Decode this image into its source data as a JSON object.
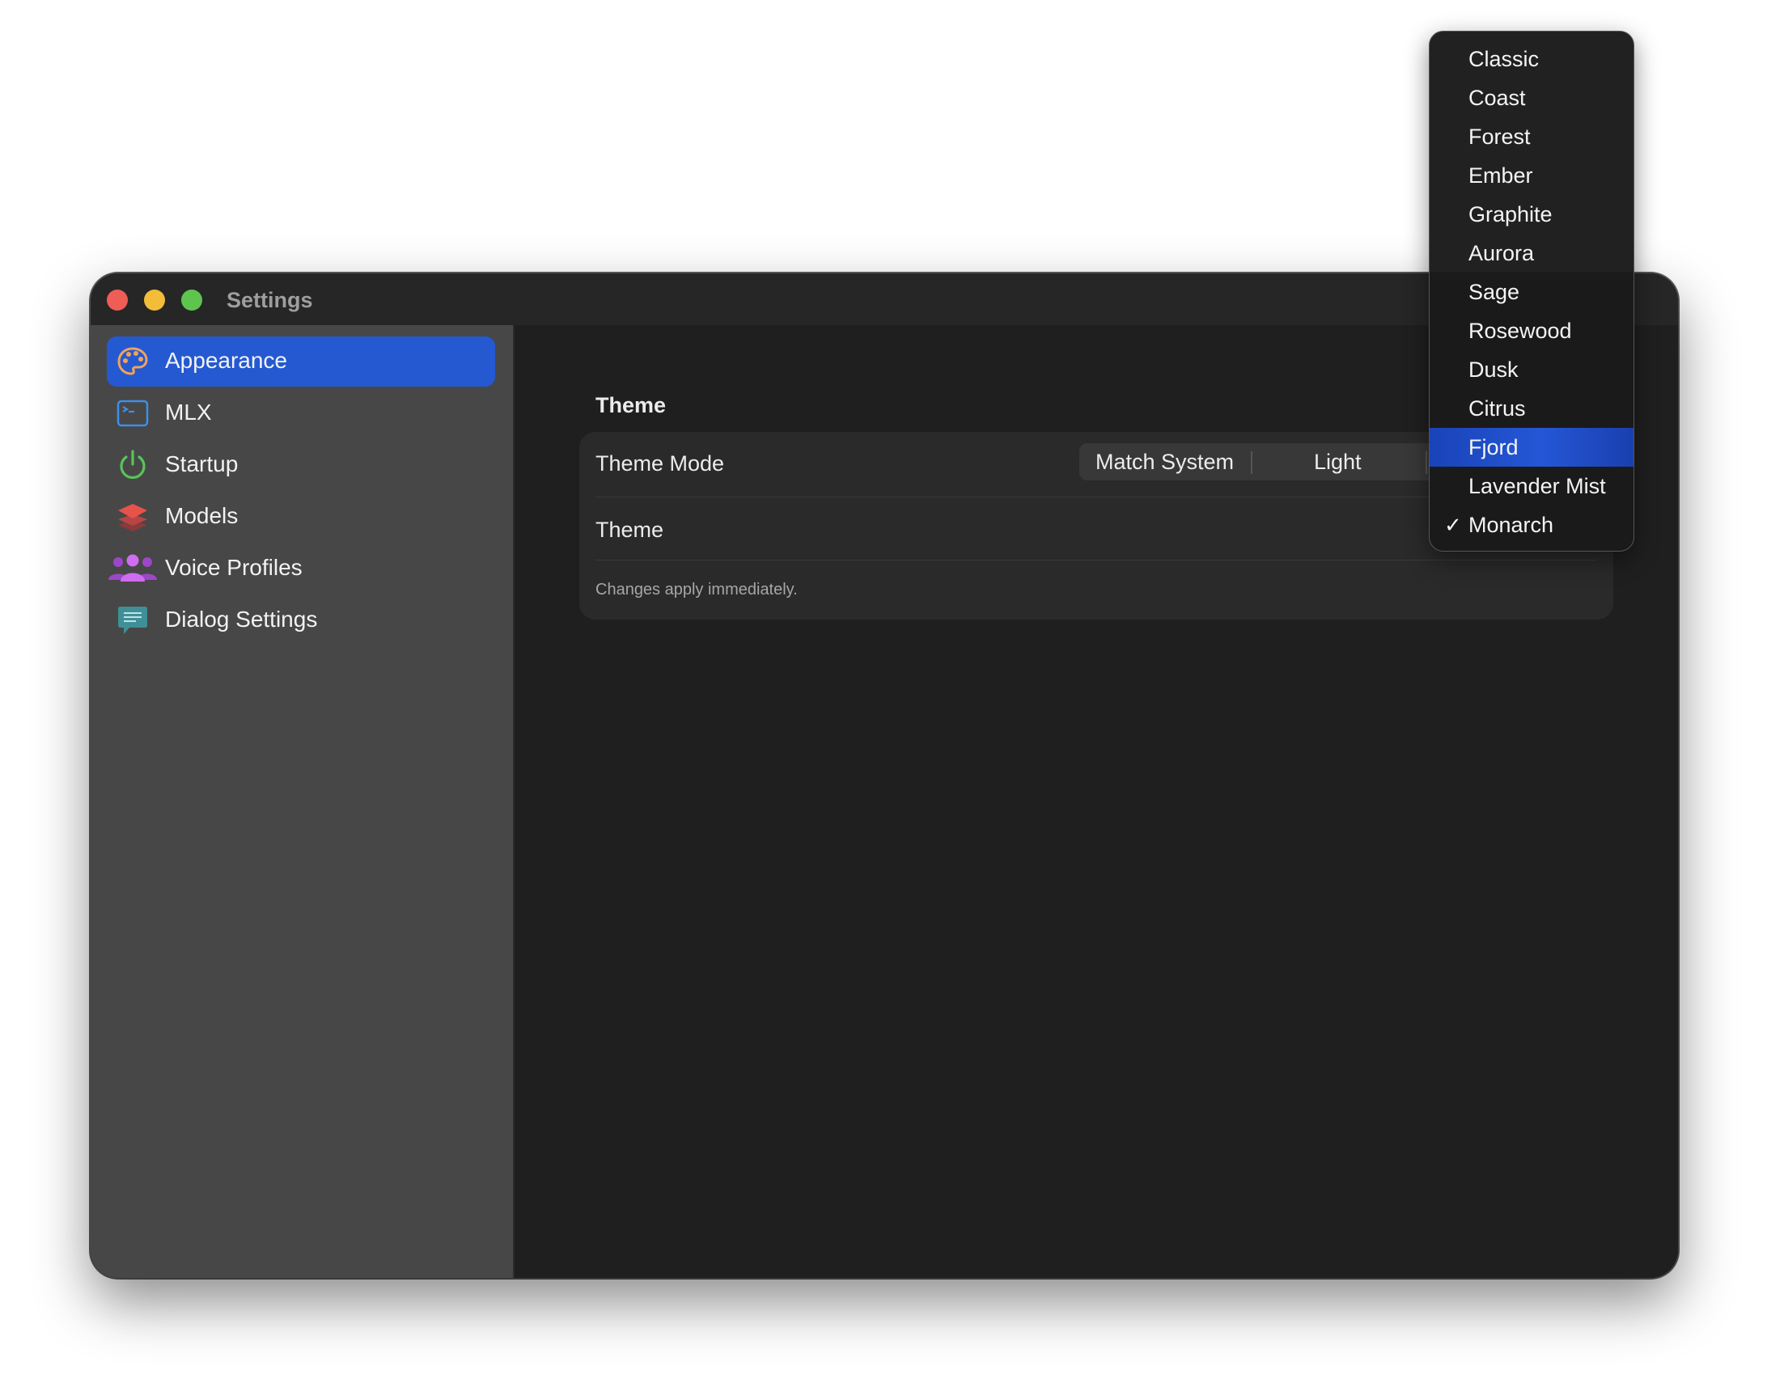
{
  "window": {
    "title": "Settings"
  },
  "sidebar": {
    "items": [
      {
        "label": "Appearance",
        "icon": "palette-icon",
        "selected": true
      },
      {
        "label": "MLX",
        "icon": "terminal-icon",
        "selected": false
      },
      {
        "label": "Startup",
        "icon": "power-icon",
        "selected": false
      },
      {
        "label": "Models",
        "icon": "layers-icon",
        "selected": false
      },
      {
        "label": "Voice Profiles",
        "icon": "people-icon",
        "selected": false
      },
      {
        "label": "Dialog Settings",
        "icon": "chat-bubble-icon",
        "selected": false
      }
    ]
  },
  "main": {
    "section_title": "Theme",
    "theme_mode": {
      "label": "Theme Mode",
      "options": [
        "Match System",
        "Light"
      ]
    },
    "theme": {
      "label": "Theme"
    },
    "footnote": "Changes apply immediately."
  },
  "theme_menu": {
    "items": [
      "Classic",
      "Coast",
      "Forest",
      "Ember",
      "Graphite",
      "Aurora",
      "Sage",
      "Rosewood",
      "Dusk",
      "Citrus",
      "Fjord",
      "Lavender Mist",
      "Monarch"
    ],
    "highlighted": "Fjord",
    "selected": "Monarch"
  },
  "colors": {
    "accent": "#2459d2",
    "sidebar_bg": "#474747",
    "content_bg": "#1f1f1f",
    "traffic_close": "#ee5d56",
    "traffic_minimize": "#f3bd3a",
    "traffic_maximize": "#5fc44e"
  }
}
